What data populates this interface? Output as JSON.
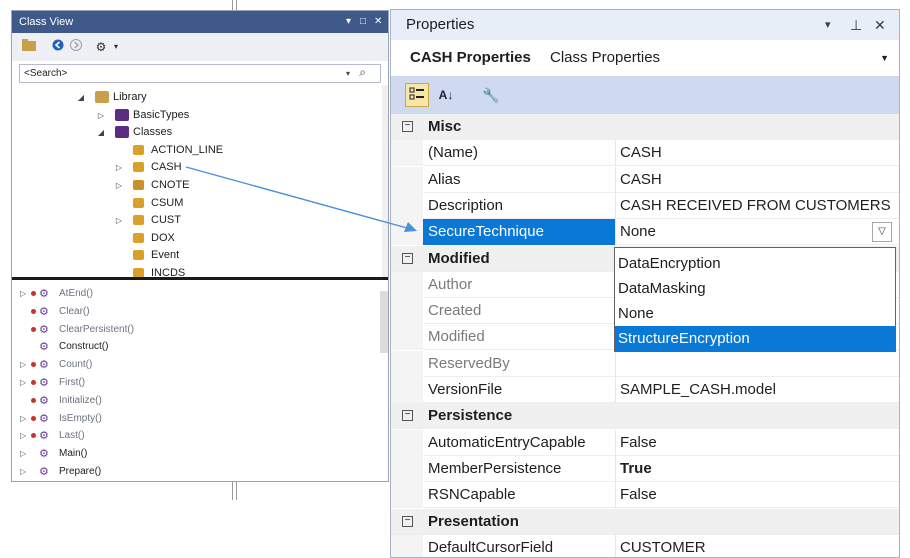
{
  "class_view": {
    "title": "Class View",
    "search_placeholder": "<Search>",
    "tree": [
      {
        "label": "Library",
        "level": 0,
        "expander": "◢",
        "icon": "folder-icon"
      },
      {
        "label": "BasicTypes",
        "level": 1,
        "expander": "▷",
        "icon": "folder-purple-icon"
      },
      {
        "label": "Classes",
        "level": 1,
        "expander": "◢",
        "icon": "folder-purple-icon"
      },
      {
        "label": "ACTION_LINE",
        "level": 2,
        "expander": "",
        "icon": "class-icon"
      },
      {
        "label": "CASH",
        "level": 2,
        "expander": "▷",
        "icon": "class-icon"
      },
      {
        "label": "CNOTE",
        "level": 2,
        "expander": "▷",
        "icon": "class-locked-icon"
      },
      {
        "label": "CSUM",
        "level": 2,
        "expander": "",
        "icon": "class-icon"
      },
      {
        "label": "CUST",
        "level": 2,
        "expander": "▷",
        "icon": "class-icon"
      },
      {
        "label": "DOX",
        "level": 2,
        "expander": "",
        "icon": "class-icon"
      },
      {
        "label": "Event",
        "level": 2,
        "expander": "",
        "icon": "class-icon"
      },
      {
        "label": "INCDS",
        "level": 2,
        "expander": "",
        "icon": "class-icon"
      }
    ],
    "members": [
      {
        "label": "AtEnd()",
        "expander": "▷",
        "dot": true,
        "style": "dim"
      },
      {
        "label": "Clear()",
        "expander": "",
        "dot": true,
        "style": "dim"
      },
      {
        "label": "ClearPersistent()",
        "expander": "",
        "dot": true,
        "style": "dim"
      },
      {
        "label": "Construct()",
        "expander": "",
        "dot": false,
        "style": "normal"
      },
      {
        "label": "Count()",
        "expander": "▷",
        "dot": true,
        "style": "dim"
      },
      {
        "label": "First()",
        "expander": "▷",
        "dot": true,
        "style": "dim"
      },
      {
        "label": "Initialize()",
        "expander": "",
        "dot": true,
        "style": "dim"
      },
      {
        "label": "IsEmpty()",
        "expander": "▷",
        "dot": true,
        "style": "dim"
      },
      {
        "label": "Last()",
        "expander": "▷",
        "dot": true,
        "style": "dim"
      },
      {
        "label": "Main()",
        "expander": "▷",
        "dot": false,
        "style": "normal"
      },
      {
        "label": "Prepare()",
        "expander": "▷",
        "dot": false,
        "style": "normal"
      }
    ]
  },
  "properties": {
    "title": "Properties",
    "object_name": "CASH Properties",
    "object_type": "Class Properties",
    "rows": [
      {
        "kind": "category",
        "name": "Misc"
      },
      {
        "kind": "prop",
        "name": "(Name)",
        "value": "CASH",
        "style": "normal"
      },
      {
        "kind": "prop",
        "name": "Alias",
        "value": "CASH",
        "style": "normal"
      },
      {
        "kind": "prop",
        "name": "Description",
        "value": "CASH RECEIVED FROM CUSTOMERS",
        "style": "normal"
      },
      {
        "kind": "prop",
        "name": "SecureTechnique",
        "value": "None",
        "style": "selected"
      },
      {
        "kind": "category",
        "name": "Modified"
      },
      {
        "kind": "prop",
        "name": "Author",
        "value": "",
        "style": "dim"
      },
      {
        "kind": "prop",
        "name": "Created",
        "value": "",
        "style": "dim"
      },
      {
        "kind": "prop",
        "name": "Modified",
        "value": "",
        "style": "dim"
      },
      {
        "kind": "prop",
        "name": "ReservedBy",
        "value": "",
        "style": "dim"
      },
      {
        "kind": "prop",
        "name": "VersionFile",
        "value": "SAMPLE_CASH.model",
        "style": "normal"
      },
      {
        "kind": "category",
        "name": "Persistence"
      },
      {
        "kind": "prop",
        "name": "AutomaticEntryCapable",
        "value": "False",
        "style": "normal"
      },
      {
        "kind": "prop",
        "name": "MemberPersistence",
        "value": "True",
        "style": "bold"
      },
      {
        "kind": "prop",
        "name": "RSNCapable",
        "value": "False",
        "style": "normal"
      },
      {
        "kind": "category",
        "name": "Presentation"
      },
      {
        "kind": "prop",
        "name": "DefaultCursorField",
        "value": "CUSTOMER",
        "style": "normal"
      }
    ],
    "dropdown_options": [
      "DataEncryption",
      "DataMasking",
      "None",
      "StructureEncryption"
    ],
    "dropdown_highlighted": "StructureEncryption"
  },
  "colors": {
    "accent": "#0a78d7",
    "class_view_title": "#3f5a8a",
    "properties_toolbar": "#cfdaf0",
    "arrow": "#4a90d9"
  }
}
